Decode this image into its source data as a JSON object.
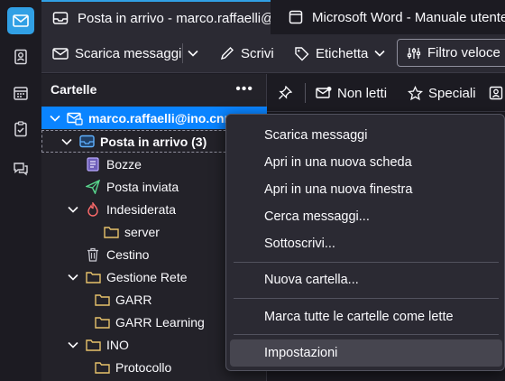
{
  "tabs": [
    {
      "label": "Posta in arrivo - marco.raffaelli@ino.cnr.it"
    },
    {
      "label": "Microsoft Word - Manuale utente"
    }
  ],
  "toolbar": {
    "get_messages": "Scarica messaggi",
    "write": "Scrivi",
    "tag": "Etichetta",
    "quick_filter": "Filtro veloce"
  },
  "folder_pane": {
    "header": "Cartelle",
    "account": "marco.raffaelli@ino.cnr.it",
    "folders": [
      {
        "label": "Posta in arrivo (3)",
        "icon": "inbox-icon"
      },
      {
        "label": "Bozze",
        "icon": "drafts-icon"
      },
      {
        "label": "Posta inviata",
        "icon": "sent-icon"
      },
      {
        "label": "Indesiderata",
        "icon": "junk-icon"
      },
      {
        "label": "server",
        "icon": "folder-icon"
      },
      {
        "label": "Cestino",
        "icon": "trash-icon"
      },
      {
        "label": "Gestione Rete",
        "icon": "folder-icon"
      },
      {
        "label": "GARR",
        "icon": "folder-icon"
      },
      {
        "label": "GARR Learning",
        "icon": "folder-icon"
      },
      {
        "label": "INO",
        "icon": "folder-icon"
      },
      {
        "label": "Protocollo",
        "icon": "folder-icon"
      }
    ]
  },
  "message_tools": {
    "unread": "Non letti",
    "starred": "Speciali"
  },
  "context_menu": {
    "items": [
      {
        "label": "Scarica messaggi"
      },
      {
        "label": "Apri in una nuova scheda"
      },
      {
        "label": "Apri in una nuova finestra"
      },
      {
        "label": "Cerca messaggi..."
      },
      {
        "label": "Sottoscrivi..."
      },
      {
        "label": "Nuova cartella..."
      },
      {
        "label": "Marca tutte le cartelle come lette"
      },
      {
        "label": "Impostazioni"
      }
    ]
  },
  "colors": {
    "accent": "#31a0e5",
    "selection": "#0a84ff",
    "background": "#1c1b22",
    "folder": "#e7c26b"
  }
}
